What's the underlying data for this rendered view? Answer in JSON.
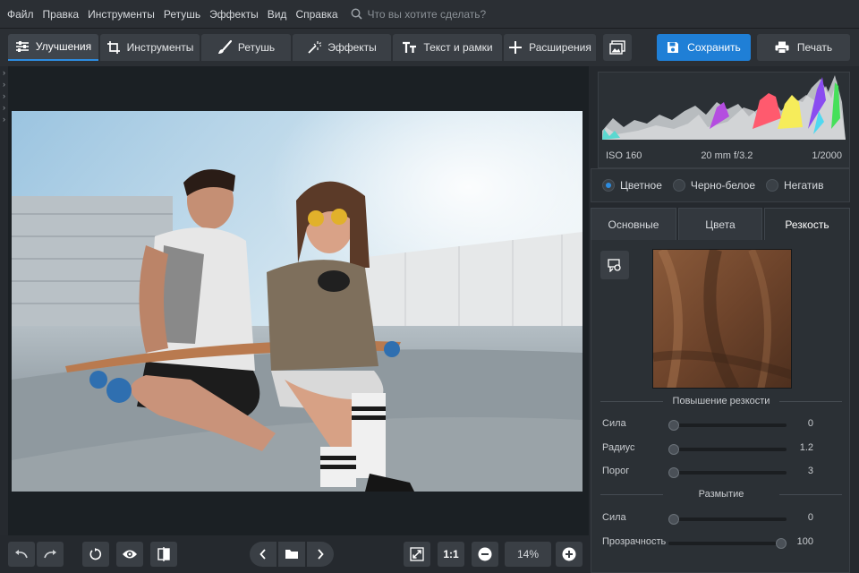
{
  "menu": [
    "Файл",
    "Правка",
    "Инструменты",
    "Ретушь",
    "Эффекты",
    "Вид",
    "Справка"
  ],
  "search": {
    "placeholder": "Что вы хотите сделать?"
  },
  "tabs": [
    {
      "label": "Улучшения",
      "icon": "sliders-icon"
    },
    {
      "label": "Инструменты",
      "icon": "crop-icon"
    },
    {
      "label": "Ретушь",
      "icon": "brush-icon"
    },
    {
      "label": "Эффекты",
      "icon": "magic-wand-icon"
    },
    {
      "label": "Текст и рамки",
      "icon": "text-icon"
    },
    {
      "label": "Расширения",
      "icon": "plus-icon"
    }
  ],
  "toolbar": {
    "save_label": "Сохранить",
    "print_label": "Печать"
  },
  "histogram": {
    "iso": "ISO 160",
    "lens": "20 mm f/3.2",
    "shutter": "1/2000"
  },
  "modes": {
    "color": "Цветное",
    "bw": "Черно-белое",
    "negative": "Негатив",
    "selected": "color"
  },
  "panel_tabs": [
    "Основные",
    "Цвета",
    "Резкость"
  ],
  "sharpen": {
    "title": "Повышение резкости",
    "rows": [
      {
        "label": "Сила",
        "value": "0",
        "fraction": 0
      },
      {
        "label": "Радиус",
        "value": "1.2",
        "fraction": 0
      },
      {
        "label": "Порог",
        "value": "3",
        "fraction": 0
      }
    ]
  },
  "blur": {
    "title": "Размытие",
    "rows": [
      {
        "label": "Сила",
        "value": "0",
        "fraction": 0
      },
      {
        "label": "Прозрачность",
        "value": "100",
        "fraction": 1
      }
    ]
  },
  "bottom": {
    "ratio": "1:1",
    "zoom": "14%"
  },
  "colors": {
    "accent": "#1f7fd6",
    "panel": "#2b3035"
  }
}
